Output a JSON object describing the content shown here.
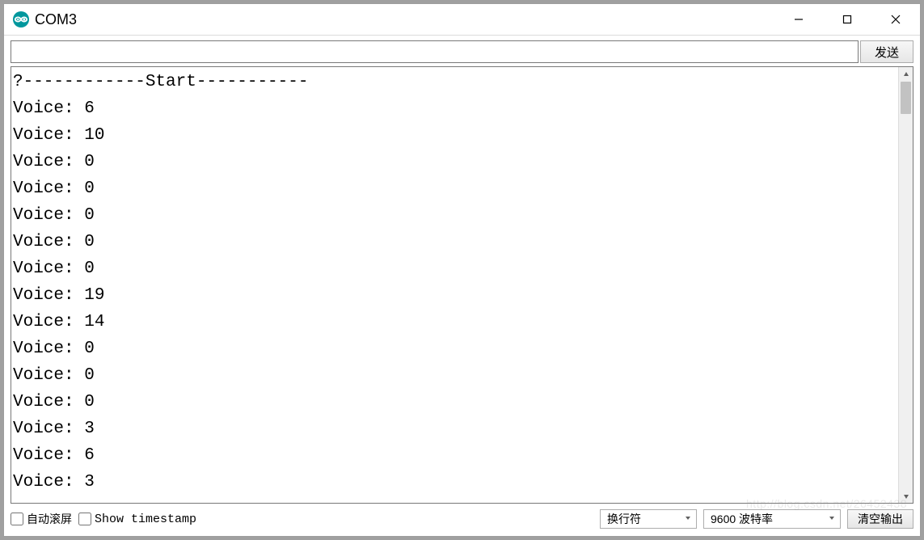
{
  "window": {
    "title": "COM3"
  },
  "send": {
    "input_value": "",
    "button_label": "发送"
  },
  "console": {
    "lines": [
      "?------------Start-----------",
      "Voice: 6",
      "Voice: 10",
      "Voice: 0",
      "Voice: 0",
      "Voice: 0",
      "Voice: 0",
      "Voice: 0",
      "Voice: 19",
      "Voice: 14",
      "Voice: 0",
      "Voice: 0",
      "Voice: 0",
      "Voice: 3",
      "Voice: 6",
      "Voice: 3"
    ]
  },
  "footer": {
    "autoscroll_label": "自动滚屏",
    "autoscroll_checked": false,
    "timestamp_label": "Show timestamp",
    "timestamp_checked": false,
    "line_ending_selected": "换行符",
    "baud_selected": "9600 波特率",
    "clear_label": "清空输出"
  },
  "watermark": "http://blog.csdn.net/26452438"
}
